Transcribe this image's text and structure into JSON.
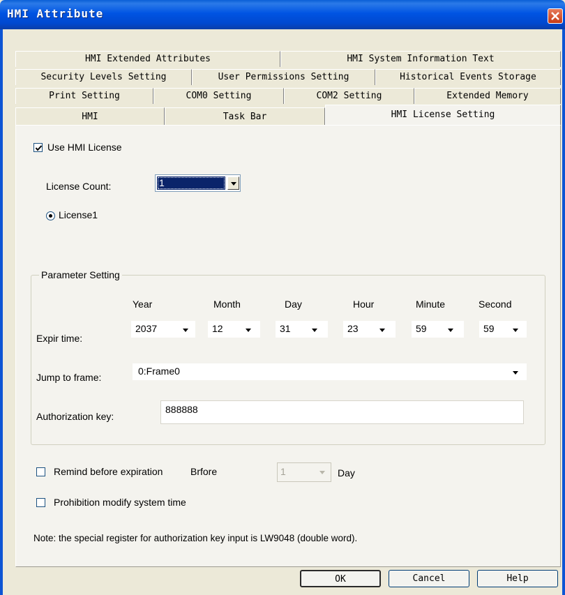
{
  "window": {
    "title": "HMI Attribute"
  },
  "tabs": {
    "row1": [
      "HMI Extended Attributes",
      "HMI System Information Text"
    ],
    "row2": [
      "Security Levels Setting",
      "User Permissions Setting",
      "Historical Events Storage"
    ],
    "row3": [
      "Print Setting",
      "COM0 Setting",
      "COM2 Setting",
      "Extended Memory"
    ],
    "row4": [
      "HMI",
      "Task Bar",
      "HMI License Setting"
    ],
    "active": "HMI License Setting"
  },
  "license": {
    "use_label": "Use HMI License",
    "use_checked": true,
    "count_label": "License Count:",
    "count_value": "1",
    "radio_label": "License1"
  },
  "params": {
    "group_title": "Parameter Setting",
    "headers": [
      "Year",
      "Month",
      "Day",
      "Hour",
      "Minute",
      "Second"
    ],
    "expire_label": "Expir time:",
    "expire_values": [
      "2037",
      "12",
      "31",
      "23",
      "59",
      "59"
    ],
    "jump_label": "Jump to frame:",
    "jump_value": "0:Frame0",
    "auth_label": "Authorization key:",
    "auth_value": "888888"
  },
  "remind": {
    "label": "Remind before expiration",
    "before_label": "Brfore",
    "value": "1",
    "unit": "Day",
    "checked": false
  },
  "prohibit": {
    "label": "Prohibition modify system time",
    "checked": false
  },
  "note": "Note: the special register for authorization key input is LW9048 (double word).",
  "buttons": {
    "ok": "OK",
    "cancel": "Cancel",
    "help": "Help"
  }
}
